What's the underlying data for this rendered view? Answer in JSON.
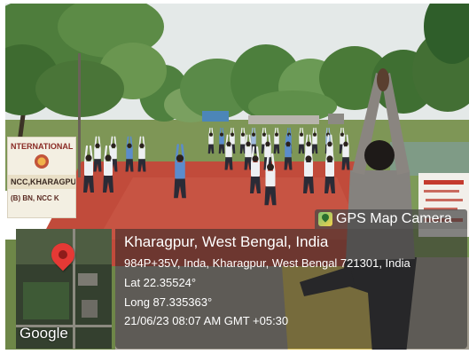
{
  "banner_left": {
    "lines": [
      "NTERNATIONAL",
      "NCC,KHARAGPUR",
      "(B) BN, NCC K"
    ]
  },
  "gps_badge": {
    "icon": "map-pin-icon",
    "label": "GPS Map Camera"
  },
  "location": {
    "place": "Kharagpur, West Bengal, India",
    "address": "984P+35V, Inda, Kharagpur, West Bengal 721301, India",
    "latitude": "Lat 22.35524°",
    "longitude": "Long 87.335363°",
    "datetime": "21/06/23 08:07 AM GMT +05:30"
  },
  "map_thumbnail": {
    "provider": "Google",
    "marker_icon": "location-marker-icon",
    "marker_color": "#e53935"
  },
  "colors": {
    "overlay_text": "#ffffff",
    "carpet": "#c14b3b"
  }
}
